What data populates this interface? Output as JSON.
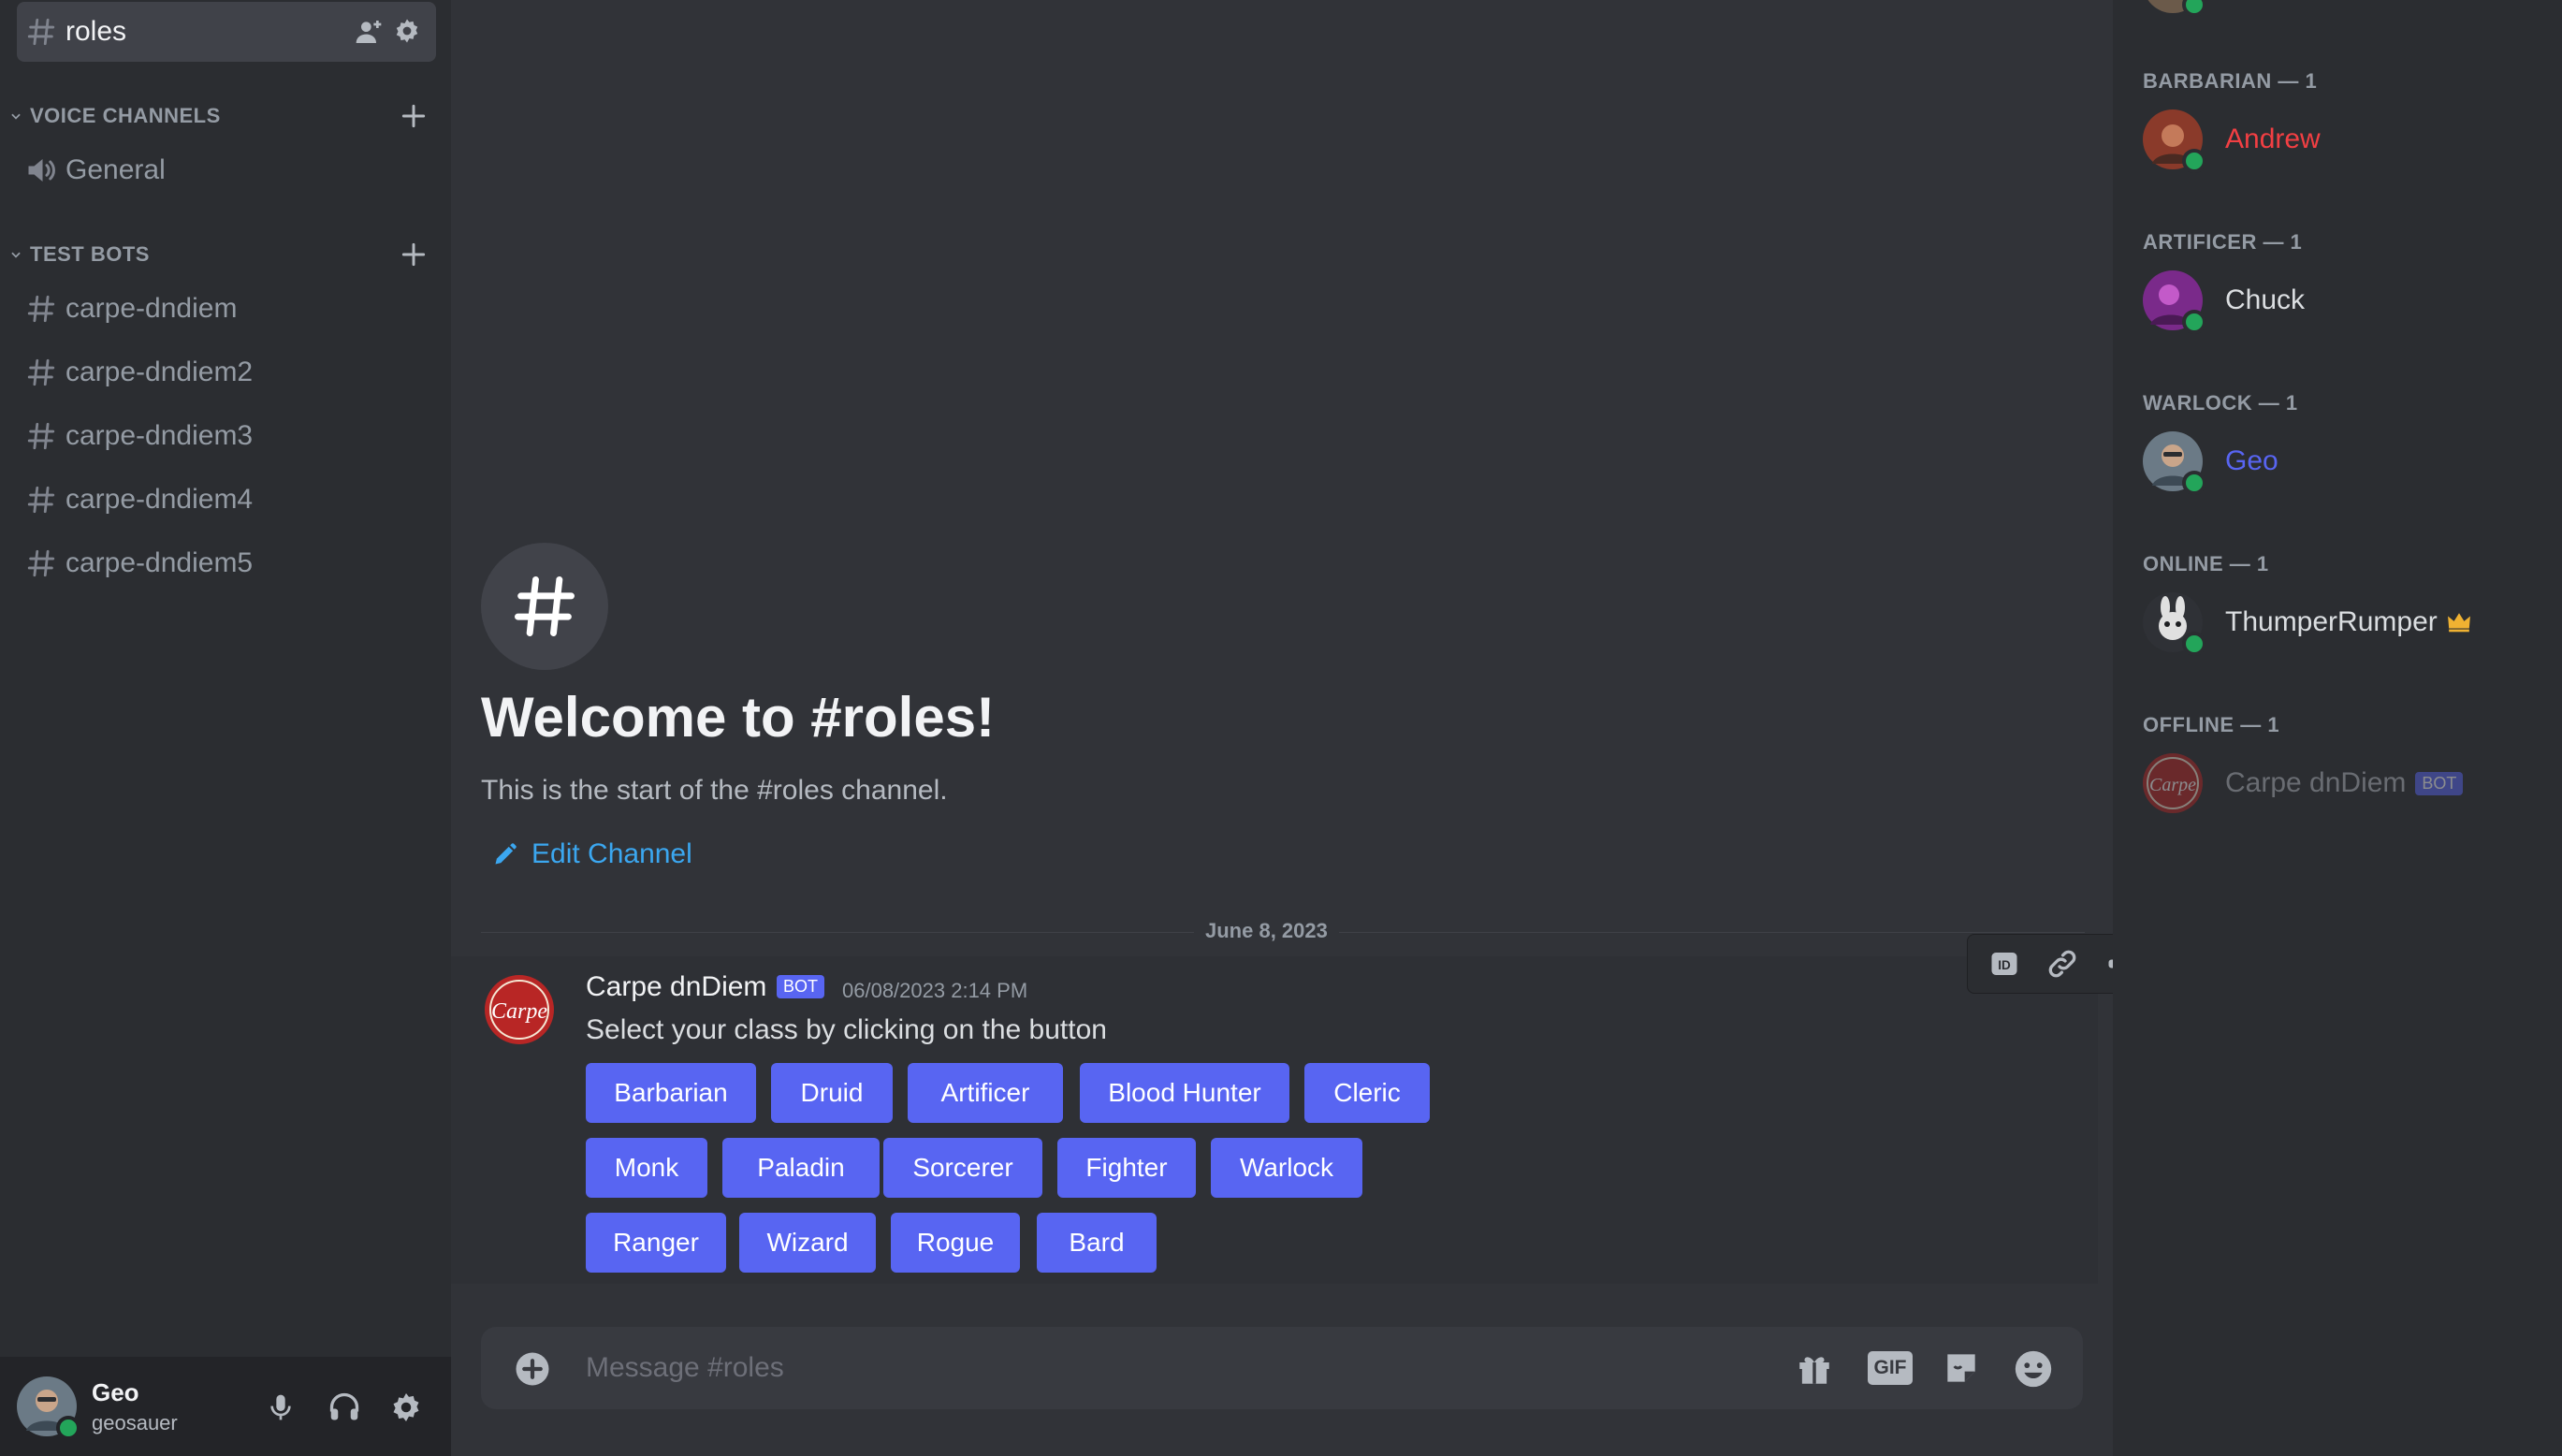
{
  "sidebar": {
    "selected_channel": "roles",
    "categories": [
      {
        "label": "VOICE CHANNELS",
        "channels": [
          "General"
        ]
      },
      {
        "label": "TEST BOTS",
        "channels": [
          "carpe-dndiem",
          "carpe-dndiem2",
          "carpe-dndiem3",
          "carpe-dndiem4",
          "carpe-dndiem5"
        ]
      }
    ],
    "user": {
      "name": "Geo",
      "username": "geosauer"
    }
  },
  "main": {
    "welcome_title": "Welcome to #roles!",
    "welcome_subtitle": "This is the start of the #roles channel.",
    "edit_channel": "Edit Channel",
    "date_separator": "June 8, 2023",
    "message": {
      "author": "Carpe dnDiem",
      "bot_tag": "BOT",
      "timestamp": "06/08/2023 2:14 PM",
      "text": "Select your class by clicking on the button",
      "avatar_text": "Carpe",
      "buttons": [
        [
          "Barbarian",
          "Druid",
          "Artificer",
          "Blood Hunter",
          "Cleric"
        ],
        [
          "Monk",
          "Paladin",
          "Sorcerer",
          "Fighter",
          "Warlock"
        ],
        [
          "Ranger",
          "Wizard",
          "Rogue",
          "Bard"
        ]
      ]
    },
    "toolbar_icons": [
      "id-icon",
      "link-icon",
      "megaphone-icon",
      "pin-icon",
      "add-reaction-icon",
      "super-reaction-icon",
      "reply-icon",
      "create-thread-icon",
      "delete-icon"
    ],
    "composer": {
      "placeholder": "Message #roles",
      "gif_label": "GIF"
    }
  },
  "members": {
    "groups": [
      {
        "header": "BARBARIAN — 1",
        "members": [
          {
            "name": "Andrew",
            "color": "#f23f43"
          }
        ]
      },
      {
        "header": "ARTIFICER — 1",
        "members": [
          {
            "name": "Chuck",
            "color": "#dbdee1"
          }
        ]
      },
      {
        "header": "WARLOCK — 1",
        "members": [
          {
            "name": "Geo",
            "color": "#5865f2"
          }
        ]
      },
      {
        "header": "ONLINE — 1",
        "members": [
          {
            "name": "ThumperRumper",
            "color": "#dbdee1"
          }
        ]
      },
      {
        "header": "OFFLINE — 1",
        "members": [
          {
            "name": "Carpe dnDiem",
            "color": "#5c5e66",
            "bot_tag": "BOT"
          }
        ]
      }
    ]
  },
  "colors": {
    "blurple": "#5865f2",
    "link": "#3ba7f0",
    "online": "#23a55a",
    "danger": "#f23f43",
    "crown": "#f0b232"
  }
}
